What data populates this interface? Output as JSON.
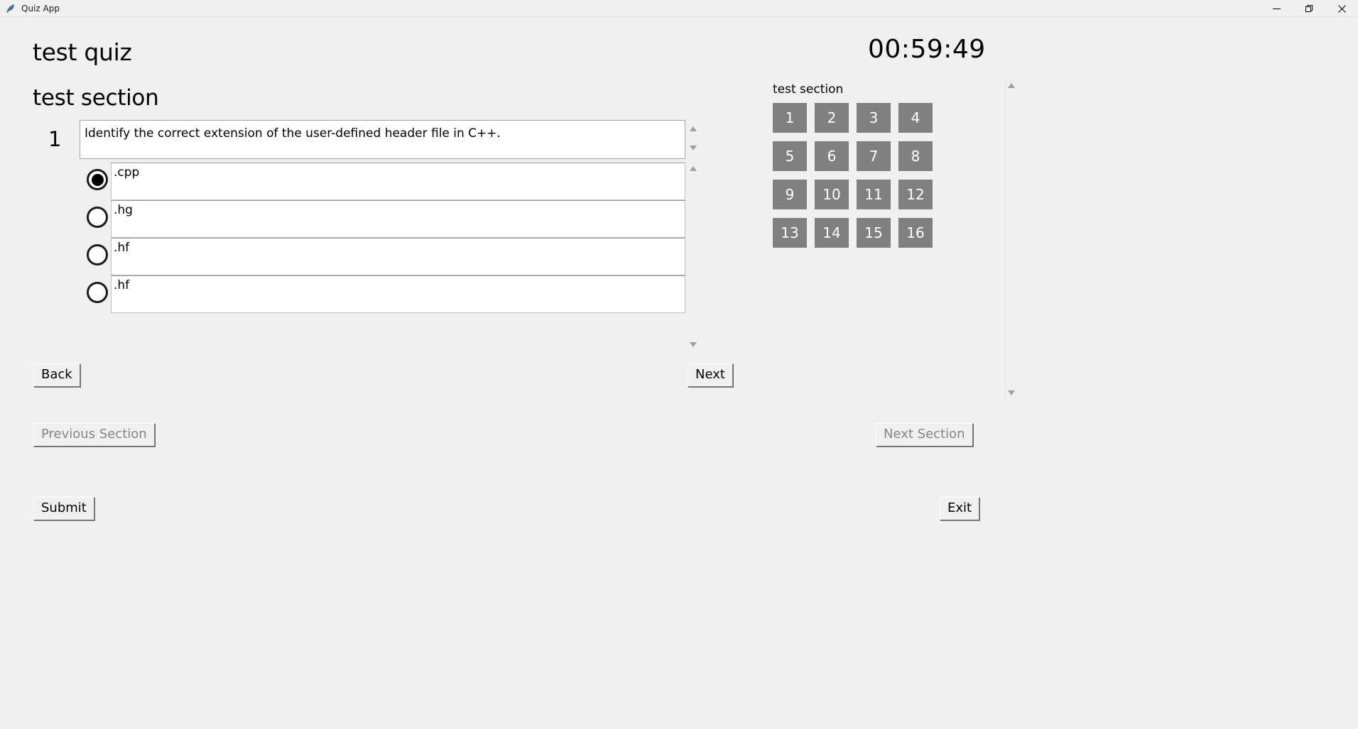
{
  "window": {
    "app_title": "Quiz App",
    "app_icon": "feather-icon",
    "controls": {
      "minimize": "minimize-icon",
      "restore": "restore-icon",
      "close": "close-icon"
    }
  },
  "header": {
    "quiz_title": "test quiz",
    "section_title": "test section",
    "timer": "00:59:49"
  },
  "question": {
    "number": "1",
    "text": "Identify the correct extension of the user-defined header file in C++.",
    "options": [
      {
        "label": ".cpp",
        "selected": true
      },
      {
        "label": ".hg",
        "selected": false
      },
      {
        "label": ".hf",
        "selected": false
      },
      {
        "label": ".hf",
        "selected": false
      }
    ]
  },
  "navigation": {
    "back": "Back",
    "next": "Next",
    "previous_section": "Previous Section",
    "next_section": "Next Section",
    "submit": "Submit",
    "exit": "Exit",
    "previous_section_enabled": false,
    "next_section_enabled": false
  },
  "navigator": {
    "section_label": "test section",
    "question_numbers": [
      "1",
      "2",
      "3",
      "4",
      "5",
      "6",
      "7",
      "8",
      "9",
      "10",
      "11",
      "12",
      "13",
      "14",
      "15",
      "16"
    ],
    "button_color": "#808080",
    "button_text_color": "#ffffff"
  },
  "theme": {
    "background": "#f0f0f0",
    "field_background": "#ffffff",
    "text": "#000000",
    "disabled_text": "#848484",
    "scrollbar_arrow": "#a0a0a0"
  }
}
